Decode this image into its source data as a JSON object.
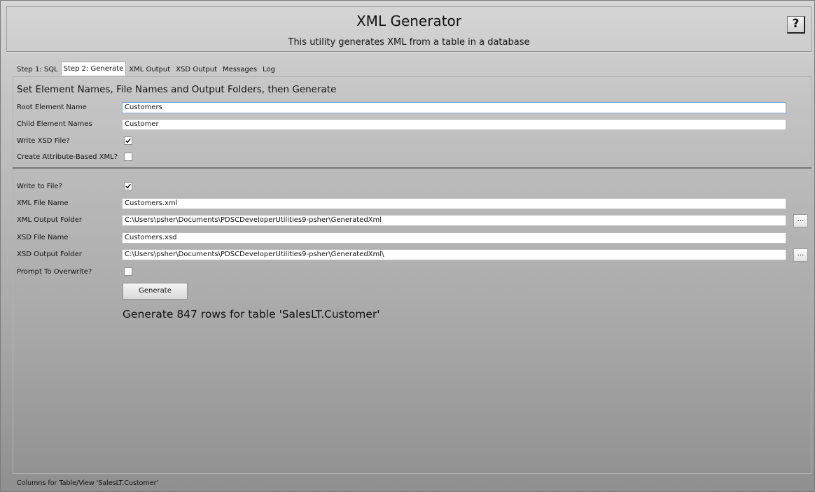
{
  "header": {
    "title": "XML Generator",
    "subtitle": "This utility generates XML from a table in a database",
    "help_label": "?"
  },
  "tabs": [
    {
      "label": "Step 1: SQL",
      "active": false
    },
    {
      "label": "Step 2: Generate",
      "active": true
    },
    {
      "label": "XML Output",
      "active": false
    },
    {
      "label": "XSD Output",
      "active": false
    },
    {
      "label": "Messages",
      "active": false
    },
    {
      "label": "Log",
      "active": false
    }
  ],
  "form": {
    "heading": "Set Element Names, File Names and Output Folders, then Generate",
    "root_element": {
      "label": "Root Element Name",
      "value": "Customers"
    },
    "child_element": {
      "label": "Child Element Names",
      "value": "Customer"
    },
    "write_xsd": {
      "label": "Write XSD File?",
      "checked": true
    },
    "attribute_based": {
      "label": "Create Attribute-Based XML?",
      "checked": false
    },
    "write_to_file": {
      "label": "Write to File?",
      "checked": true
    },
    "xml_file_name": {
      "label": "XML File Name",
      "value": "Customers.xml"
    },
    "xml_output_folder": {
      "label": "XML Output Folder",
      "value": "C:\\Users\\psher\\Documents\\PDSCDeveloperUtilities9-psher\\GeneratedXml"
    },
    "xsd_file_name": {
      "label": "XSD File Name",
      "value": "Customers.xsd"
    },
    "xsd_output_folder": {
      "label": "XSD Output Folder",
      "value": "C:\\Users\\psher\\Documents\\PDSCDeveloperUtilities9-psher\\GeneratedXml\\"
    },
    "prompt_overwrite": {
      "label": "Prompt To Overwrite?",
      "checked": false
    },
    "browse_label": "...",
    "generate_label": "Generate",
    "result_message": "Generate 847 rows for table 'SalesLT.Customer'"
  },
  "status_bar": {
    "text": "Columns for Table/View 'SalesLT.Customer'"
  }
}
